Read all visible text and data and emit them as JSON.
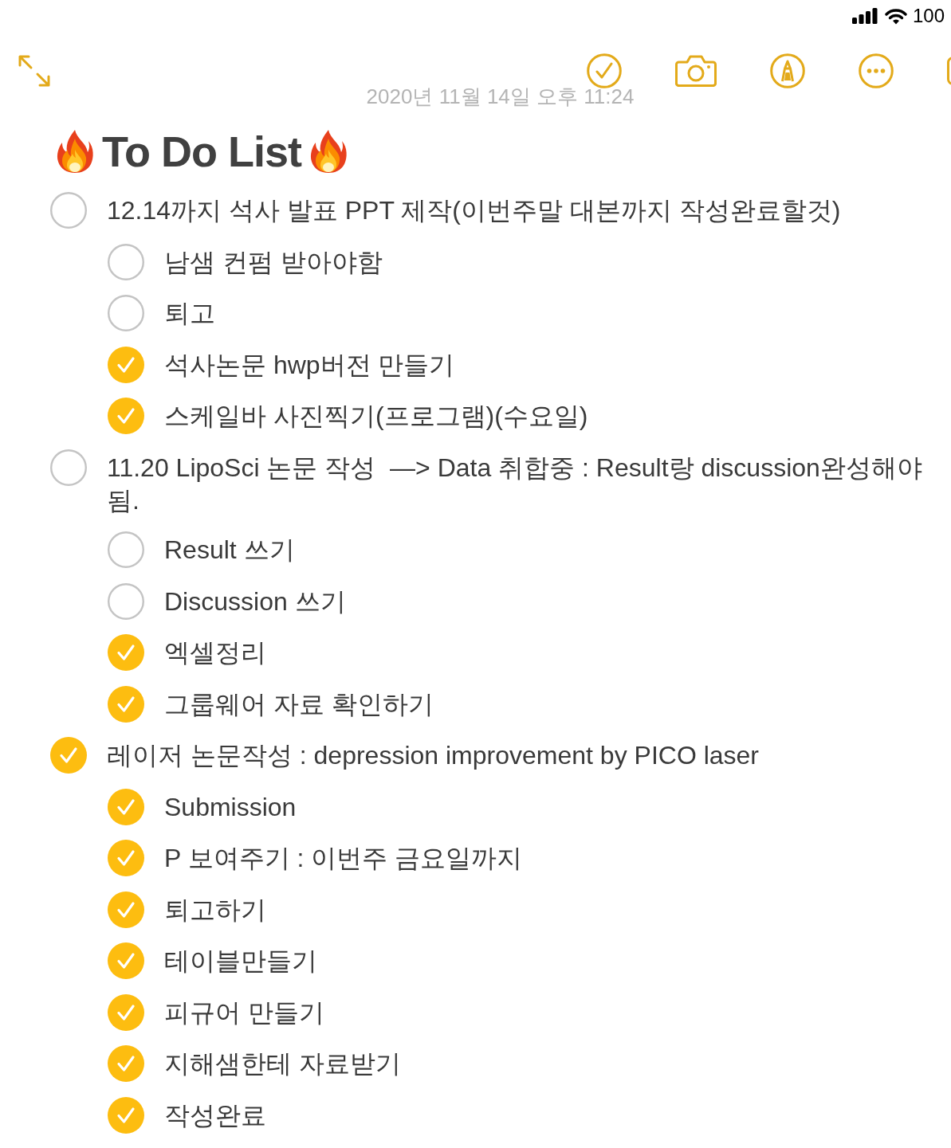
{
  "status_bar": {
    "battery_text": "100"
  },
  "toolbar": {
    "date": "2020년 11월 14일 오후 11:24"
  },
  "note": {
    "title": "To Do List",
    "items": [
      {
        "text": "12.14까지 석사 발표 PPT 제작(이번주말 대본까지 작성완료할것)",
        "checked": false,
        "children": [
          {
            "text": "남샘 컨펌 받아야함",
            "checked": false
          },
          {
            "text": "퇴고",
            "checked": false
          },
          {
            "text": "석사논문 hwp버전 만들기",
            "checked": true
          },
          {
            "text": "스케일바 사진찍기(프로그램)(수요일)",
            "checked": true
          }
        ]
      },
      {
        "text": "11.20 LipoSci 논문 작성  —> Data 취합중 : Result랑 discussion완성해야됨.",
        "checked": false,
        "children": [
          {
            "text": "Result 쓰기",
            "checked": false
          },
          {
            "text": "Discussion 쓰기",
            "checked": false
          },
          {
            "text": "엑셀정리",
            "checked": true
          },
          {
            "text": "그룹웨어 자료 확인하기",
            "checked": true
          }
        ]
      },
      {
        "text": "레이저 논문작성 : depression improvement by PICO laser",
        "checked": true,
        "children": [
          {
            "text": "Submission",
            "checked": true
          },
          {
            "text": "P 보여주기 : 이번주 금요일까지",
            "checked": true
          },
          {
            "text": "퇴고하기",
            "checked": true
          },
          {
            "text": "테이블만들기",
            "checked": true
          },
          {
            "text": "피규어 만들기",
            "checked": true
          },
          {
            "text": "지해샘한테 자료받기",
            "checked": true
          },
          {
            "text": "작성완료",
            "checked": true
          }
        ]
      }
    ]
  }
}
